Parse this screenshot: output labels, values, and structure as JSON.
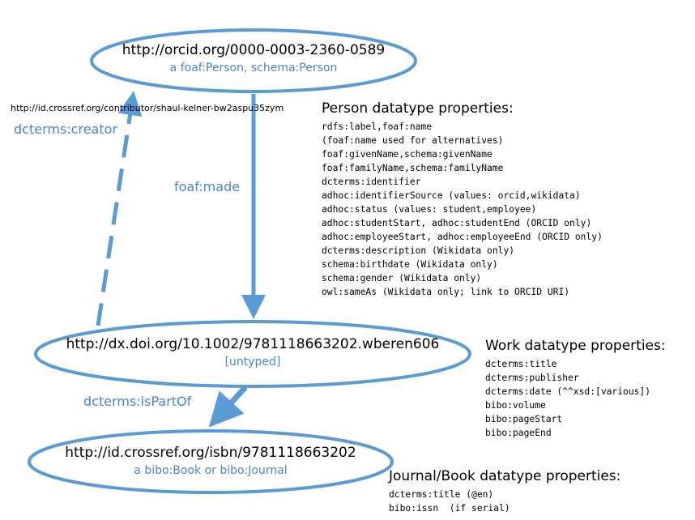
{
  "nodes": {
    "person": {
      "uri": "http://orcid.org/0000-0003-2360-0589",
      "type": "a foaf:Person, schema:Person"
    },
    "work": {
      "uri": "http://dx.doi.org/10.1002/9781118663202.wberen606",
      "type": "[untyped]"
    },
    "container": {
      "uri": "http://id.crossref.org/isbn/9781118663202",
      "type": "a bibo:Book or bibo:Journal"
    }
  },
  "edges": {
    "creator": {
      "label": "dcterms:creator",
      "uri": "http://id.crossref.org/contributor/shaul-kelner-bw2aspu35zym"
    },
    "made": {
      "label": "foaf:made"
    },
    "is_part_of": {
      "label": "dcterms:isPartOf"
    }
  },
  "colors": {
    "ellipse": "#5b9bd5",
    "label": "#4a86c8"
  },
  "person_properties": {
    "title": "Person datatype properties:",
    "items": [
      "rdfs:label,foaf:name",
      "(foaf:name used for alternatives)",
      "foaf:givenName,schema:givenName",
      "foaf:familyName,schema:familyName",
      "dcterms:identifier",
      "adhoc:identifierSource (values: orcid,wikidata)",
      "adhoc:status (values: student,employee)",
      "adhoc:studentStart, adhoc:studentEnd (ORCID only)",
      "adhoc:employeeStart, adhoc:employeeEnd (ORCID only)",
      "dcterms:description (Wikidata only)",
      "schema:birthdate (Wikidata only)",
      "schema:gender (Wikidata only)",
      "owl:sameAs (Wikidata only; link to ORCID URI)"
    ]
  },
  "work_properties": {
    "title": "Work datatype properties:",
    "items": [
      "dcterms:title",
      "dcterms:publisher",
      "dcterms:date (^^xsd:[various])",
      "bibo:volume",
      "bibo:pageStart",
      "bibo:pageEnd"
    ]
  },
  "journal_properties": {
    "title": "Journal/Book datatype properties:",
    "items": [
      "dcterms:title (@en)",
      "bibo:issn  (if serial)"
    ]
  }
}
